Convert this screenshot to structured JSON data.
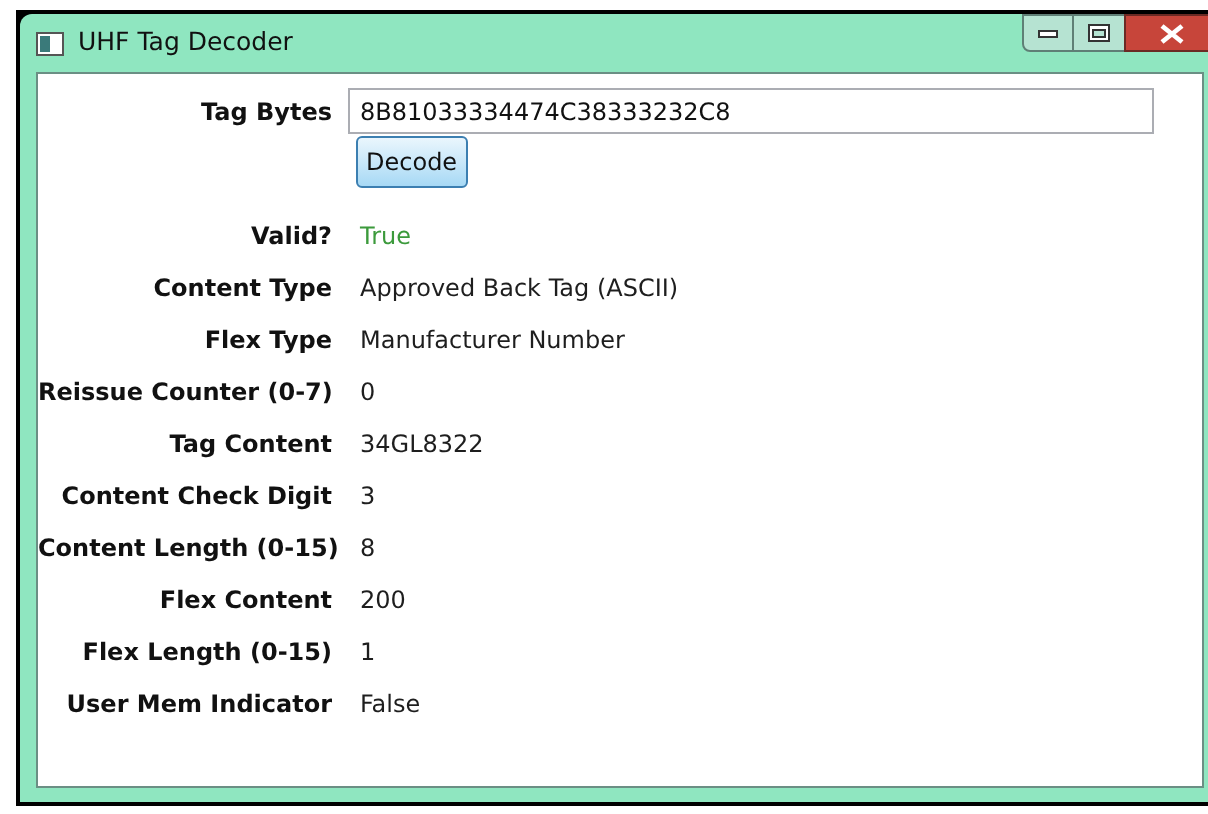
{
  "window": {
    "title": "UHF Tag Decoder"
  },
  "tag_bytes": {
    "label": "Tag Bytes",
    "value": "8B81033334474C38333232C8"
  },
  "decode_button": {
    "label": "Decode"
  },
  "fields": [
    {
      "label": "Valid?",
      "value": "True",
      "color": "#3c9a3c"
    },
    {
      "label": "Content Type",
      "value": "Approved Back Tag (ASCII)",
      "color": "#1e1e1e"
    },
    {
      "label": "Flex Type",
      "value": "Manufacturer Number",
      "color": "#1e1e1e"
    },
    {
      "label": "Reissue Counter (0-7)",
      "value": "0",
      "color": "#1e1e1e"
    },
    {
      "label": "Tag Content",
      "value": "34GL8322",
      "color": "#1e1e1e"
    },
    {
      "label": "Content Check Digit",
      "value": "3",
      "color": "#1e1e1e"
    },
    {
      "label": "Content Length (0-15)",
      "value": "8",
      "color": "#1e1e1e"
    },
    {
      "label": "Flex Content",
      "value": "200",
      "color": "#1e1e1e"
    },
    {
      "label": "Flex Length (0-15)",
      "value": "1",
      "color": "#1e1e1e"
    },
    {
      "label": "User Mem Indicator",
      "value": "False",
      "color": "#1e1e1e"
    }
  ]
}
